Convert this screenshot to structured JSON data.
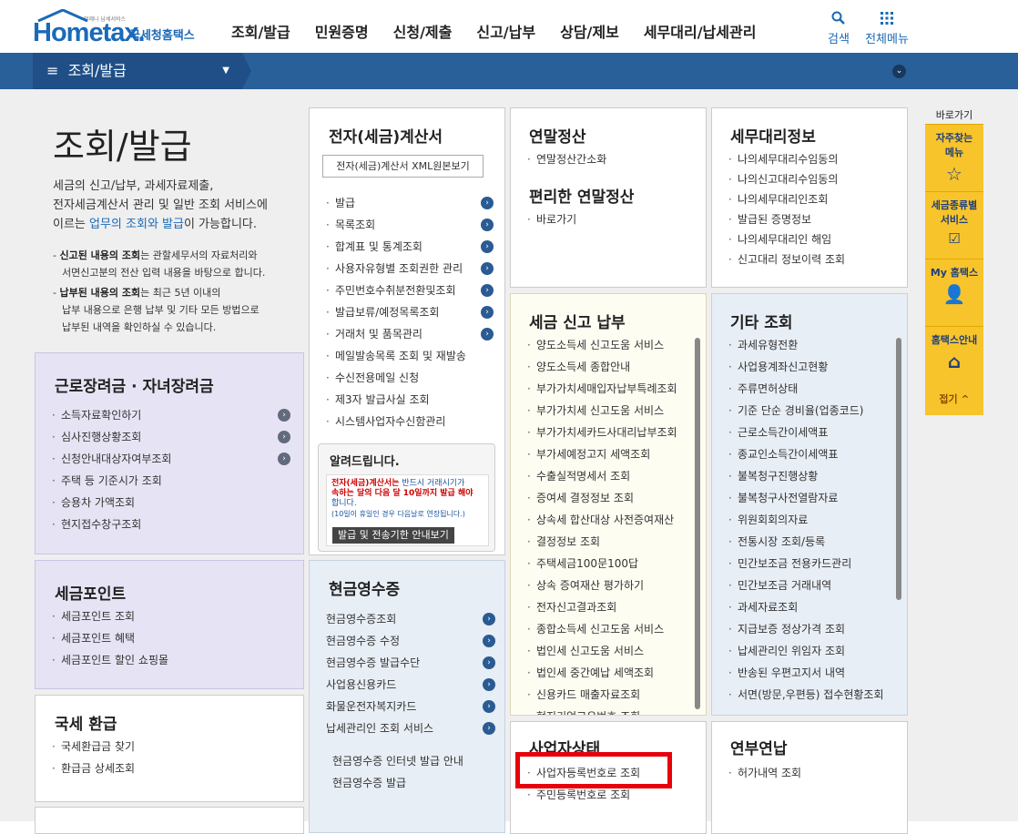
{
  "header": {
    "logo_main": "Hometax.",
    "logo_sub": "국세청홈택스",
    "logo_small": "언제나 납세서비스",
    "nav": [
      "조회/발급",
      "민원증명",
      "신청/제출",
      "신고/납부",
      "상담/제보",
      "세무대리/납세관리"
    ],
    "search_label": "검색",
    "allmenu_label": "전체메뉴"
  },
  "breadcrumb": {
    "current": "조회/발급"
  },
  "intro": {
    "title": "조회/발급",
    "desc1": "세금의 신고/납부, 과세자료제출,",
    "desc2": "전자세금계산서 관리 및 일반 조회 서비스에",
    "desc3_pre": "이르는 ",
    "desc3_hl": "업무의 조회와 발급",
    "desc3_post": "이 가능합니다.",
    "note1_b": "신고된 내용의 조회",
    "note1_r": "는 관할세무서의 자료처리와",
    "note1_l2": "서면신고분의 전산 입력 내용을 바탕으로 합니다.",
    "note2_b": "납부된 내용의 조회",
    "note2_r": "는 최근 5년 이내의",
    "note2_l2": "납부 내용으로 은행 납부 및 기타 모든 방법으로",
    "note2_l3": "납부된 내역을 확인하실 수 있습니다."
  },
  "panels": {
    "einvoice": {
      "title": "전자(세금)계산서",
      "xml_button": "전자(세금)계산서 XML원본보기",
      "items": [
        "발급",
        "목록조회",
        "합계표 및 통계조회",
        "사용자유형별 조회권한 관리",
        "주민번호수취분전환및조회",
        "발급보류/예정목록조회",
        "거래처 및 품목관리",
        "메일발송목록 조회 및 재발송",
        "수신전용메일 신청",
        "제3자 발급사실 조회",
        "시스템사업자수신함관리"
      ]
    },
    "alert": {
      "title": "알려드립니다.",
      "text1_red": "전자(세금)계산서는",
      "text1_rest": " 반드시 거래시기가",
      "text2": "속하는 달의 다음 달 10일까지 발급 해야",
      "text3": "합니다.",
      "text4": "(10일이 휴일인 경우 다음날로 연장됩니다.)",
      "button": "발급 및 전송기한 안내보기"
    },
    "yearend": {
      "title": "연말정산",
      "items": [
        "연말정산간소화"
      ],
      "title2": "편리한 연말정산",
      "items2": [
        "바로가기"
      ]
    },
    "taxagent": {
      "title": "세무대리정보",
      "items": [
        "나의세무대리수임동의",
        "나의신고대리수임동의",
        "나의세무대리인조회",
        "발급된 증명정보",
        "나의세무대리인 해임",
        "신고대리 정보이력 조회"
      ]
    },
    "labor": {
      "title": "근로장려금 · 자녀장려금",
      "items": [
        "소득자료확인하기",
        "심사진행상황조회",
        "신청안내대상자여부조회",
        "주택 등 기준시가 조회",
        "승용차 가액조회",
        "현지접수창구조회"
      ]
    },
    "taxreport": {
      "title": "세금 신고 납부",
      "items": [
        "양도소득세 신고도움 서비스",
        "양도소득세 종합안내",
        "부가가치세매입자납부특례조회",
        "부가가치세 신고도움 서비스",
        "부가가치세카드사대리납부조회",
        "부가세예정고지 세액조회",
        "수출실적명세서 조회",
        "증여세 결정정보 조회",
        "상속세 합산대상 사전증여재산",
        "결정정보 조회",
        "주택세금100문100답",
        "상속 증여재산 평가하기",
        "전자신고결과조회",
        "종합소득세 신고도움 서비스",
        "법인세 신고도움 서비스",
        "법인세 중간예납 세액조회",
        "신용카드 매출자료조회",
        "현지기업고유번호 조회"
      ]
    },
    "other": {
      "title": "기타 조회",
      "items": [
        "과세유형전환",
        "사업용계좌신고현황",
        "주류면허상태",
        "기준 단순 경비율(업종코드)",
        "근로소득간이세액표",
        "종교인소득간이세액표",
        "불복청구진행상황",
        "불복청구사전열람자료",
        "위원회회의자료",
        "전통시장 조회/등록",
        "민간보조금 전용카드관리",
        "민간보조금 거래내역",
        "과세자료조회",
        "지급보증 정상가격 조회",
        "납세관리인 위임자 조회",
        "반송된 우편고지서 내역",
        "서면(방문,우편등) 접수현황조회"
      ]
    },
    "taxpoint": {
      "title": "세금포인트",
      "items": [
        "세금포인트 조회",
        "세금포인트 혜택",
        "세금포인트 할인 쇼핑몰"
      ]
    },
    "cashreceipt": {
      "title": "현금영수증",
      "items": [
        "현금영수증조회",
        "현금영수증 수정",
        "현금영수증 발급수단",
        "사업용신용카드",
        "화물운전자복지카드",
        "납세관리인 조회 서비스"
      ],
      "items2": [
        "현금영수증 인터넷 발급 안내",
        "현금영수증 발급"
      ]
    },
    "refund": {
      "title": "국세 환급",
      "items": [
        "국세환급금 찾기",
        "환급금 상세조회"
      ]
    },
    "bizstatus": {
      "title": "사업자상태",
      "items": [
        "사업자등록번호로 조회",
        "주민등록번호로 조회"
      ]
    },
    "yearpay": {
      "title": "연부연납",
      "items": [
        "허가내역 조회"
      ]
    }
  },
  "quick": {
    "title": "바로가기",
    "boxes": [
      {
        "label1": "자주찾는",
        "label2": "메뉴",
        "icon": "star-icon"
      },
      {
        "label1": "세금종류별",
        "label2": "서비스",
        "icon": "check-icon"
      },
      {
        "label1": "My 홈택스",
        "label2": "",
        "icon": "person-icon"
      },
      {
        "label1": "홈택스안내",
        "label2": "",
        "icon": "house-icon"
      }
    ],
    "close": "접기 ^"
  }
}
